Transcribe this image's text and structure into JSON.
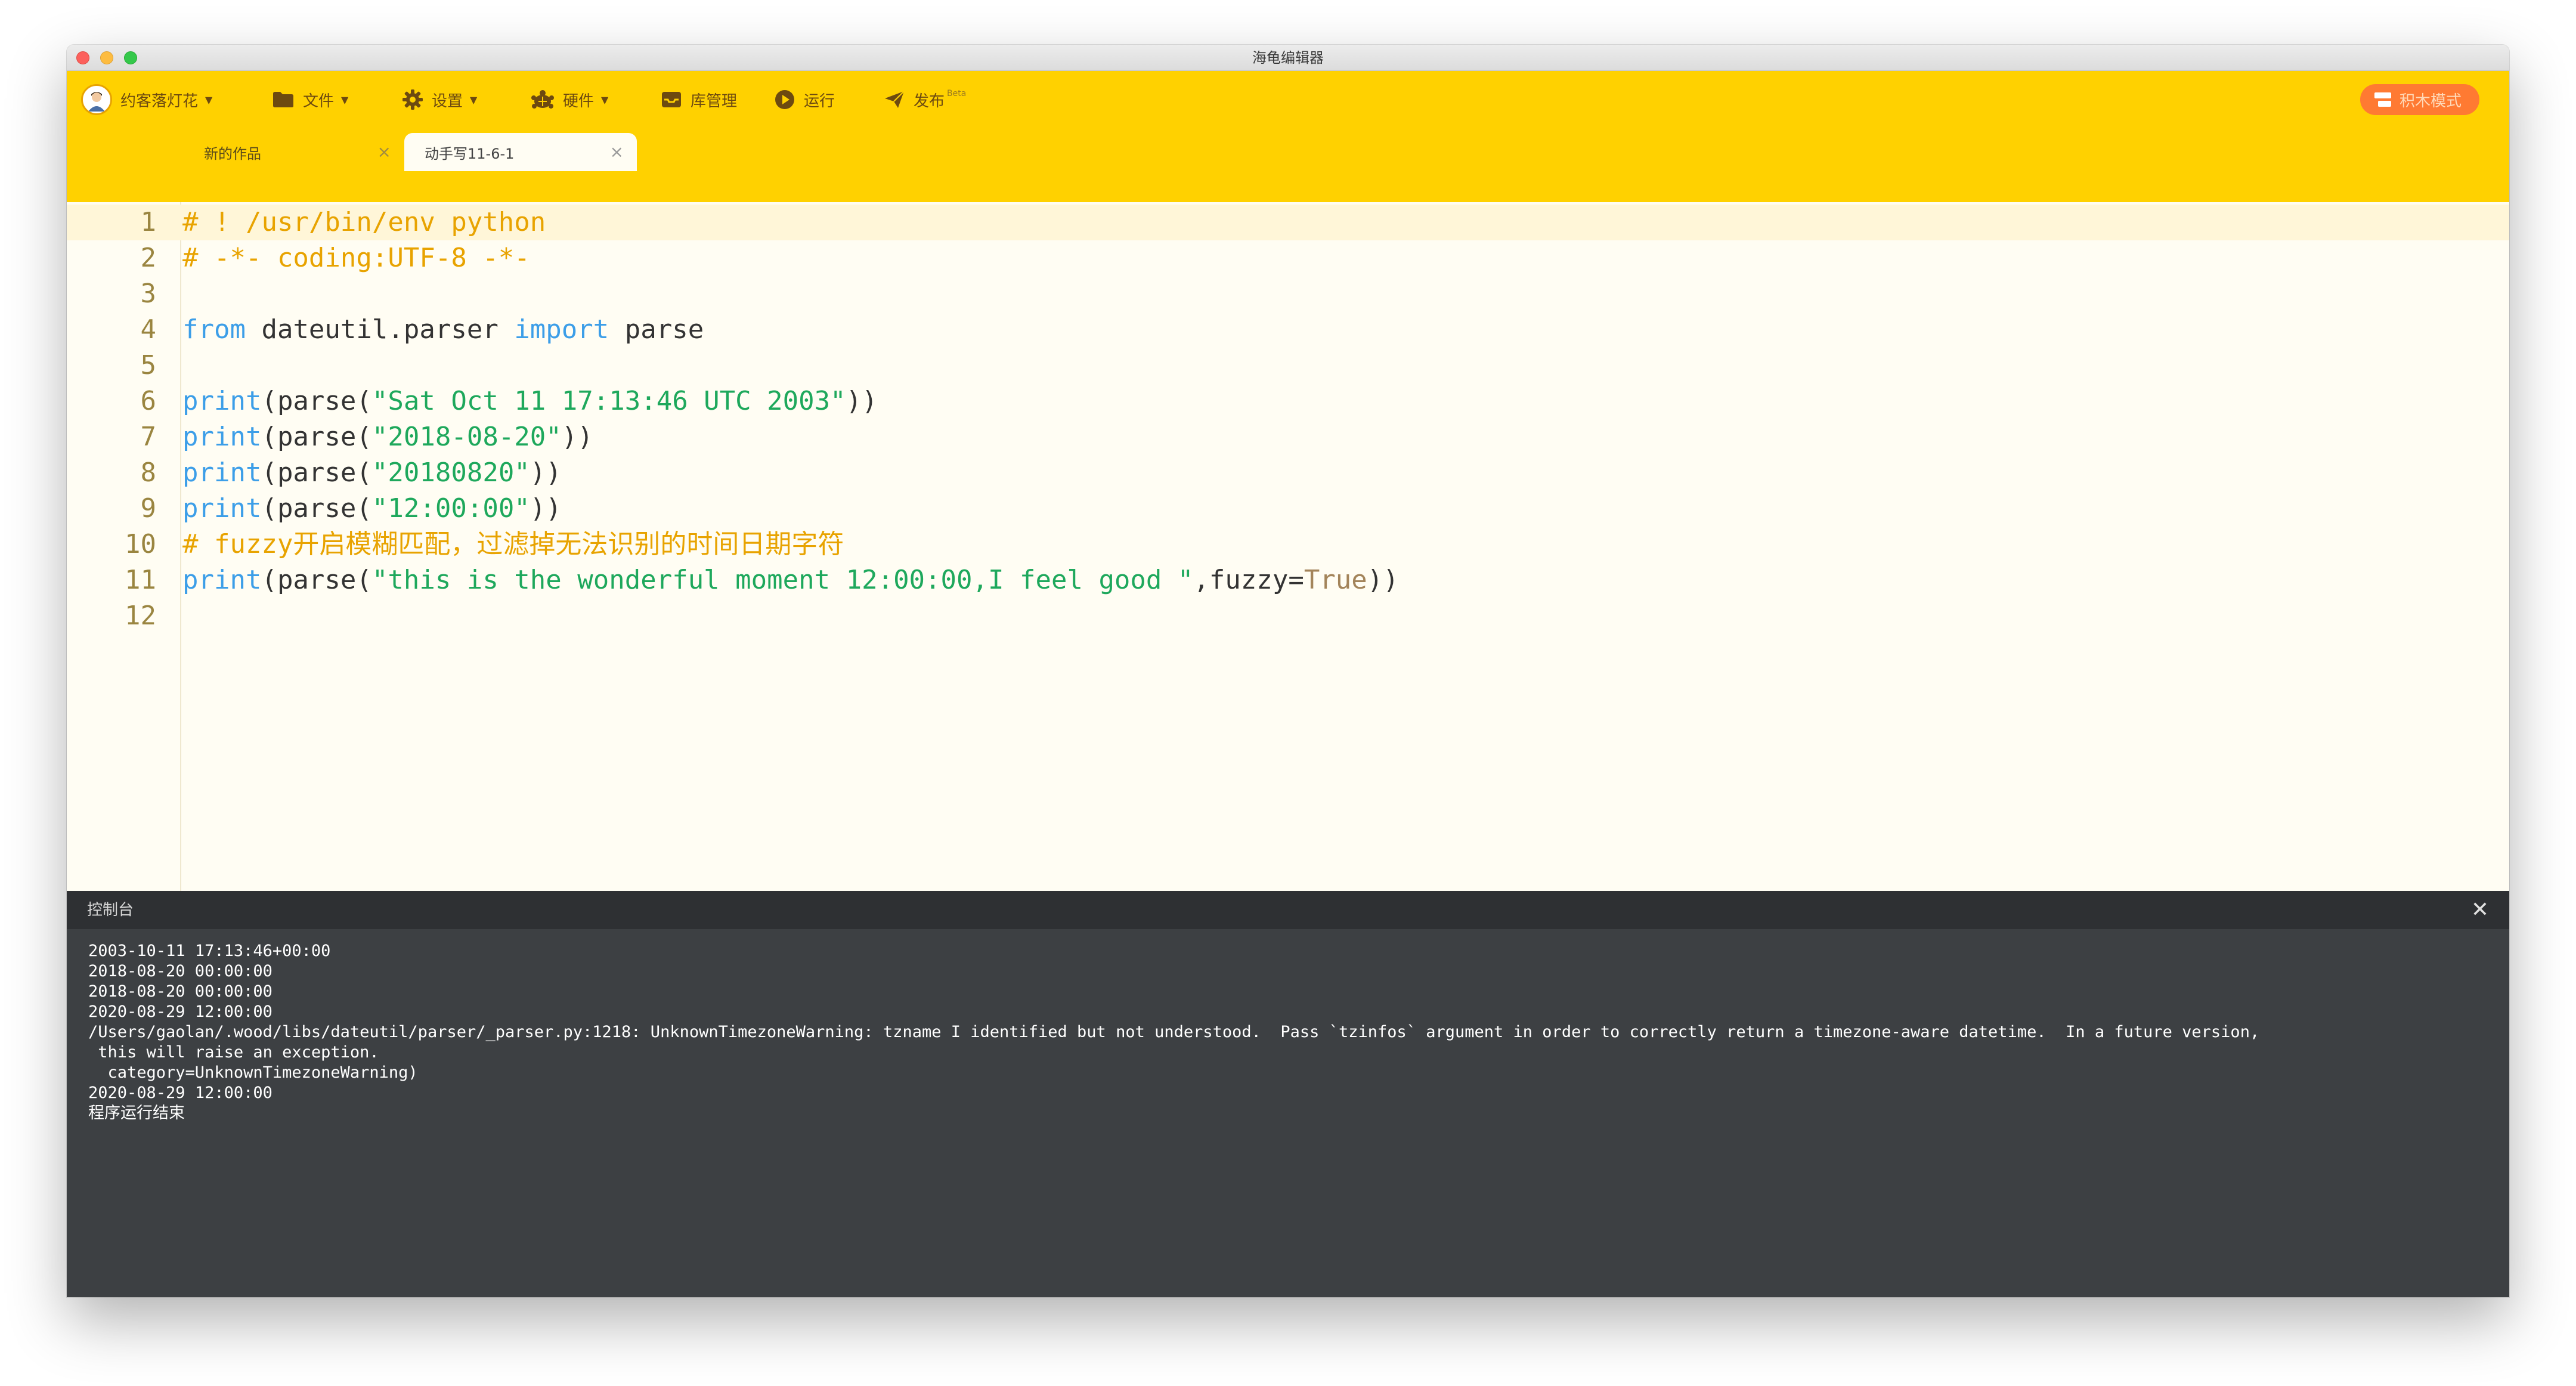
{
  "window": {
    "title": "海龟编辑器"
  },
  "toolbar": {
    "user": "约客落灯花",
    "file": "文件",
    "settings": "设置",
    "hardware": "硬件",
    "library": "库管理",
    "run": "运行",
    "publish": "发布",
    "publish_badge": "Beta",
    "block_mode": "积木模式"
  },
  "tabs": [
    {
      "title": "新的作品",
      "close": "×"
    },
    {
      "title": "动手写11-6-1",
      "close": "×"
    }
  ],
  "editor": {
    "lines": [
      {
        "n": "1",
        "tokens": [
          {
            "t": "# ! /usr/bin/env python",
            "c": "comment"
          }
        ]
      },
      {
        "n": "2",
        "tokens": [
          {
            "t": "# -*- coding:UTF-8 -*-",
            "c": "comment"
          }
        ]
      },
      {
        "n": "3",
        "tokens": []
      },
      {
        "n": "4",
        "tokens": [
          {
            "t": "from",
            "c": "keyword"
          },
          {
            "t": " dateutil.parser ",
            "c": "plain"
          },
          {
            "t": "import",
            "c": "keyword"
          },
          {
            "t": " parse",
            "c": "plain"
          }
        ]
      },
      {
        "n": "5",
        "tokens": []
      },
      {
        "n": "6",
        "tokens": [
          {
            "t": "print",
            "c": "func"
          },
          {
            "t": "(parse(",
            "c": "plain"
          },
          {
            "t": "\"Sat Oct 11 17:13:46 UTC 2003\"",
            "c": "string"
          },
          {
            "t": "))",
            "c": "plain"
          }
        ]
      },
      {
        "n": "7",
        "tokens": [
          {
            "t": "print",
            "c": "func"
          },
          {
            "t": "(parse(",
            "c": "plain"
          },
          {
            "t": "\"2018-08-20\"",
            "c": "string"
          },
          {
            "t": "))",
            "c": "plain"
          }
        ]
      },
      {
        "n": "8",
        "tokens": [
          {
            "t": "print",
            "c": "func"
          },
          {
            "t": "(parse(",
            "c": "plain"
          },
          {
            "t": "\"20180820\"",
            "c": "string"
          },
          {
            "t": "))",
            "c": "plain"
          }
        ]
      },
      {
        "n": "9",
        "tokens": [
          {
            "t": "print",
            "c": "func"
          },
          {
            "t": "(parse(",
            "c": "plain"
          },
          {
            "t": "\"12:00:00\"",
            "c": "string"
          },
          {
            "t": "))",
            "c": "plain"
          }
        ]
      },
      {
        "n": "10",
        "tokens": [
          {
            "t": "# fuzzy开启模糊匹配，过滤掉无法识别的时间日期字符",
            "c": "comment"
          }
        ]
      },
      {
        "n": "11",
        "tokens": [
          {
            "t": "print",
            "c": "func"
          },
          {
            "t": "(parse(",
            "c": "plain"
          },
          {
            "t": "\"this is the wonderful moment 12:00:00,I feel good \"",
            "c": "string"
          },
          {
            "t": ",fuzzy=",
            "c": "plain"
          },
          {
            "t": "True",
            "c": "const"
          },
          {
            "t": "))",
            "c": "plain"
          }
        ]
      },
      {
        "n": "12",
        "tokens": []
      }
    ]
  },
  "run_button": {
    "label": "运行"
  },
  "console": {
    "title": "控制台",
    "close": "✕",
    "output": [
      "2003-10-11 17:13:46+00:00",
      "2018-08-20 00:00:00",
      "2018-08-20 00:00:00",
      "2020-08-29 12:00:00",
      "/Users/gaolan/.wood/libs/dateutil/parser/_parser.py:1218: UnknownTimezoneWarning: tzname I identified but not understood.  Pass `tzinfos` argument in order to correctly return a timezone-aware datetime.  In a future version,",
      " this will raise an exception.",
      "  category=UnknownTimezoneWarning)",
      "2020-08-29 12:00:00",
      "程序运行结束"
    ]
  },
  "colors": {
    "accent": "#ffd100",
    "block_mode": "#ff7a32",
    "comment": "#e8a300",
    "keyword": "#3c9ee8",
    "string": "#1ea85c",
    "console_bg": "#3d4043"
  }
}
